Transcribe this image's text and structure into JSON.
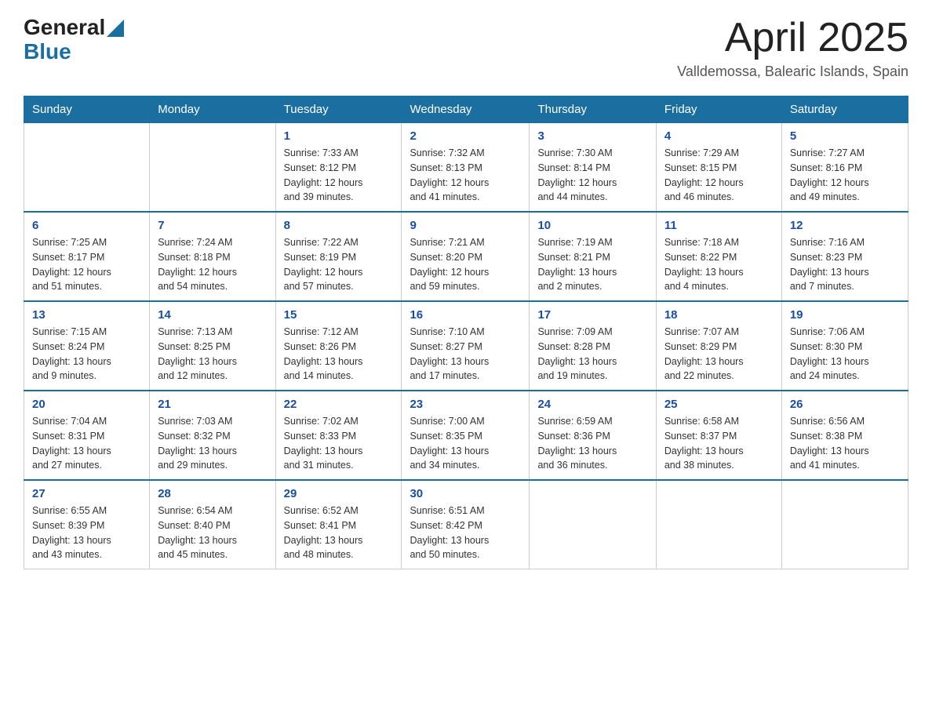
{
  "header": {
    "logo": {
      "general": "General",
      "blue": "Blue"
    },
    "title": "April 2025",
    "subtitle": "Valldemossa, Balearic Islands, Spain"
  },
  "calendar": {
    "days": [
      "Sunday",
      "Monday",
      "Tuesday",
      "Wednesday",
      "Thursday",
      "Friday",
      "Saturday"
    ],
    "weeks": [
      [
        {
          "day": "",
          "info": ""
        },
        {
          "day": "",
          "info": ""
        },
        {
          "day": "1",
          "info": "Sunrise: 7:33 AM\nSunset: 8:12 PM\nDaylight: 12 hours\nand 39 minutes."
        },
        {
          "day": "2",
          "info": "Sunrise: 7:32 AM\nSunset: 8:13 PM\nDaylight: 12 hours\nand 41 minutes."
        },
        {
          "day": "3",
          "info": "Sunrise: 7:30 AM\nSunset: 8:14 PM\nDaylight: 12 hours\nand 44 minutes."
        },
        {
          "day": "4",
          "info": "Sunrise: 7:29 AM\nSunset: 8:15 PM\nDaylight: 12 hours\nand 46 minutes."
        },
        {
          "day": "5",
          "info": "Sunrise: 7:27 AM\nSunset: 8:16 PM\nDaylight: 12 hours\nand 49 minutes."
        }
      ],
      [
        {
          "day": "6",
          "info": "Sunrise: 7:25 AM\nSunset: 8:17 PM\nDaylight: 12 hours\nand 51 minutes."
        },
        {
          "day": "7",
          "info": "Sunrise: 7:24 AM\nSunset: 8:18 PM\nDaylight: 12 hours\nand 54 minutes."
        },
        {
          "day": "8",
          "info": "Sunrise: 7:22 AM\nSunset: 8:19 PM\nDaylight: 12 hours\nand 57 minutes."
        },
        {
          "day": "9",
          "info": "Sunrise: 7:21 AM\nSunset: 8:20 PM\nDaylight: 12 hours\nand 59 minutes."
        },
        {
          "day": "10",
          "info": "Sunrise: 7:19 AM\nSunset: 8:21 PM\nDaylight: 13 hours\nand 2 minutes."
        },
        {
          "day": "11",
          "info": "Sunrise: 7:18 AM\nSunset: 8:22 PM\nDaylight: 13 hours\nand 4 minutes."
        },
        {
          "day": "12",
          "info": "Sunrise: 7:16 AM\nSunset: 8:23 PM\nDaylight: 13 hours\nand 7 minutes."
        }
      ],
      [
        {
          "day": "13",
          "info": "Sunrise: 7:15 AM\nSunset: 8:24 PM\nDaylight: 13 hours\nand 9 minutes."
        },
        {
          "day": "14",
          "info": "Sunrise: 7:13 AM\nSunset: 8:25 PM\nDaylight: 13 hours\nand 12 minutes."
        },
        {
          "day": "15",
          "info": "Sunrise: 7:12 AM\nSunset: 8:26 PM\nDaylight: 13 hours\nand 14 minutes."
        },
        {
          "day": "16",
          "info": "Sunrise: 7:10 AM\nSunset: 8:27 PM\nDaylight: 13 hours\nand 17 minutes."
        },
        {
          "day": "17",
          "info": "Sunrise: 7:09 AM\nSunset: 8:28 PM\nDaylight: 13 hours\nand 19 minutes."
        },
        {
          "day": "18",
          "info": "Sunrise: 7:07 AM\nSunset: 8:29 PM\nDaylight: 13 hours\nand 22 minutes."
        },
        {
          "day": "19",
          "info": "Sunrise: 7:06 AM\nSunset: 8:30 PM\nDaylight: 13 hours\nand 24 minutes."
        }
      ],
      [
        {
          "day": "20",
          "info": "Sunrise: 7:04 AM\nSunset: 8:31 PM\nDaylight: 13 hours\nand 27 minutes."
        },
        {
          "day": "21",
          "info": "Sunrise: 7:03 AM\nSunset: 8:32 PM\nDaylight: 13 hours\nand 29 minutes."
        },
        {
          "day": "22",
          "info": "Sunrise: 7:02 AM\nSunset: 8:33 PM\nDaylight: 13 hours\nand 31 minutes."
        },
        {
          "day": "23",
          "info": "Sunrise: 7:00 AM\nSunset: 8:35 PM\nDaylight: 13 hours\nand 34 minutes."
        },
        {
          "day": "24",
          "info": "Sunrise: 6:59 AM\nSunset: 8:36 PM\nDaylight: 13 hours\nand 36 minutes."
        },
        {
          "day": "25",
          "info": "Sunrise: 6:58 AM\nSunset: 8:37 PM\nDaylight: 13 hours\nand 38 minutes."
        },
        {
          "day": "26",
          "info": "Sunrise: 6:56 AM\nSunset: 8:38 PM\nDaylight: 13 hours\nand 41 minutes."
        }
      ],
      [
        {
          "day": "27",
          "info": "Sunrise: 6:55 AM\nSunset: 8:39 PM\nDaylight: 13 hours\nand 43 minutes."
        },
        {
          "day": "28",
          "info": "Sunrise: 6:54 AM\nSunset: 8:40 PM\nDaylight: 13 hours\nand 45 minutes."
        },
        {
          "day": "29",
          "info": "Sunrise: 6:52 AM\nSunset: 8:41 PM\nDaylight: 13 hours\nand 48 minutes."
        },
        {
          "day": "30",
          "info": "Sunrise: 6:51 AM\nSunset: 8:42 PM\nDaylight: 13 hours\nand 50 minutes."
        },
        {
          "day": "",
          "info": ""
        },
        {
          "day": "",
          "info": ""
        },
        {
          "day": "",
          "info": ""
        }
      ]
    ]
  }
}
